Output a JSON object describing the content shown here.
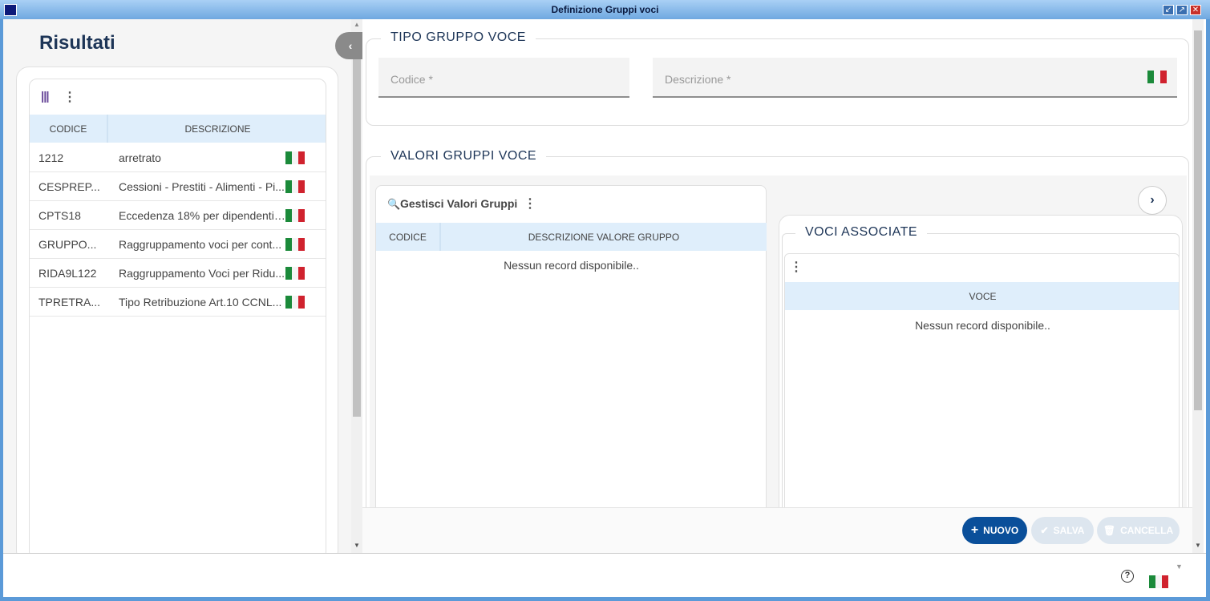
{
  "window": {
    "title": "Definizione Gruppi voci"
  },
  "left": {
    "title": "Risultati",
    "columns": [
      "CODICE",
      "DESCRIZIONE"
    ],
    "rows": [
      {
        "codice": "1212",
        "descrizione": "arretrato"
      },
      {
        "codice": "CESPREP...",
        "descrizione": "Cessioni - Prestiti - Alimenti - Pi..."
      },
      {
        "codice": "CPTS18",
        "descrizione": "Eccedenza 18% per dipendenti i..."
      },
      {
        "codice": "GRUPPO...",
        "descrizione": "Raggruppamento voci per cont..."
      },
      {
        "codice": "RIDA9L122",
        "descrizione": "Raggruppamento Voci per Ridu..."
      },
      {
        "codice": "TPRETRA...",
        "descrizione": "Tipo Retribuzione Art.10 CCNL..."
      }
    ]
  },
  "tipo": {
    "legend": "TIPO GRUPPO VOCE",
    "codice_placeholder": "Codice *",
    "descrizione_placeholder": "Descrizione *"
  },
  "valori": {
    "legend": "VALORI GRUPPI VOCE",
    "gestisci": {
      "title": "Gestisci Valori Gruppi",
      "columns": [
        "CODICE",
        "DESCRIZIONE VALORE GRUPPO"
      ],
      "empty": "Nessun record disponibile.."
    },
    "voci": {
      "legend": "VOCI ASSOCIATE",
      "columns": [
        "VOCE"
      ],
      "empty": "Nessun record disponibile.."
    }
  },
  "actions": {
    "nuovo": "NUOVO",
    "salva": "SALVA",
    "cancella": "CANCELLA"
  },
  "footer": {
    "help": "?"
  },
  "colors": {
    "primary": "#0a4f9a",
    "header": "#dfeefb",
    "title": "#1d3557"
  }
}
